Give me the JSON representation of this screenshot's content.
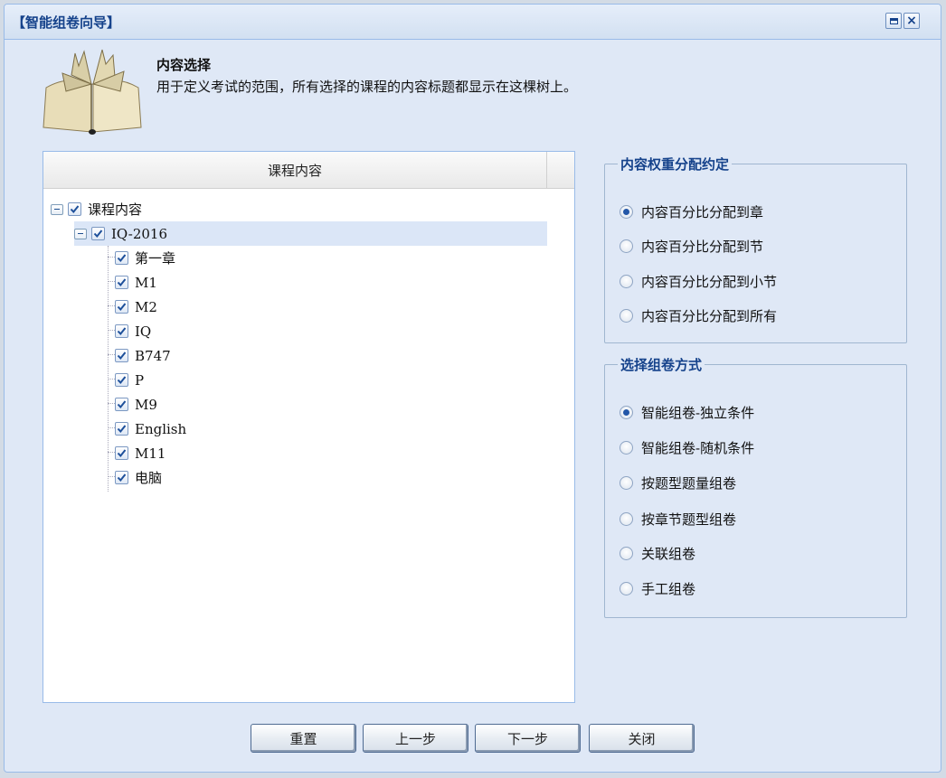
{
  "window": {
    "title": "【智能组卷向导】"
  },
  "header": {
    "title": "内容选择",
    "description": "用于定义考试的范围，所有选择的课程的内容标题都显示在这棵树上。"
  },
  "tree": {
    "column_header": "课程内容",
    "root": {
      "label": "课程内容",
      "checked": true,
      "expanded": true
    },
    "course": {
      "label": "IQ-2016",
      "checked": true,
      "expanded": true,
      "selected": true
    },
    "children": [
      {
        "label": "第一章",
        "checked": true
      },
      {
        "label": "M1",
        "checked": true
      },
      {
        "label": "M2",
        "checked": true
      },
      {
        "label": "IQ",
        "checked": true
      },
      {
        "label": "B747",
        "checked": true
      },
      {
        "label": "P",
        "checked": true
      },
      {
        "label": "M9",
        "checked": true
      },
      {
        "label": "English",
        "checked": true
      },
      {
        "label": "M11",
        "checked": true
      },
      {
        "label": "电脑",
        "checked": true
      }
    ]
  },
  "weight_group": {
    "legend": "内容权重分配约定",
    "options": [
      {
        "label": "内容百分比分配到章",
        "selected": true
      },
      {
        "label": "内容百分比分配到节",
        "selected": false
      },
      {
        "label": "内容百分比分配到小节",
        "selected": false
      },
      {
        "label": "内容百分比分配到所有",
        "selected": false
      }
    ]
  },
  "method_group": {
    "legend": "选择组卷方式",
    "options": [
      {
        "label": "智能组卷-独立条件",
        "selected": true
      },
      {
        "label": "智能组卷-随机条件",
        "selected": false
      },
      {
        "label": "按题型题量组卷",
        "selected": false
      },
      {
        "label": "按章节题型组卷",
        "selected": false
      },
      {
        "label": "关联组卷",
        "selected": false
      },
      {
        "label": "手工组卷",
        "selected": false
      }
    ]
  },
  "buttons": {
    "reset": "重置",
    "prev": "上一步",
    "next": "下一步",
    "close": "关闭"
  },
  "colors": {
    "accent": "#15428b",
    "border": "#99bbe8",
    "background": "#dfe8f6",
    "selection": "#dbe6f7"
  },
  "icons": {
    "book": "open-book-icon",
    "max": "maximize-icon",
    "close": "close-icon",
    "check": "checkmark-icon"
  }
}
